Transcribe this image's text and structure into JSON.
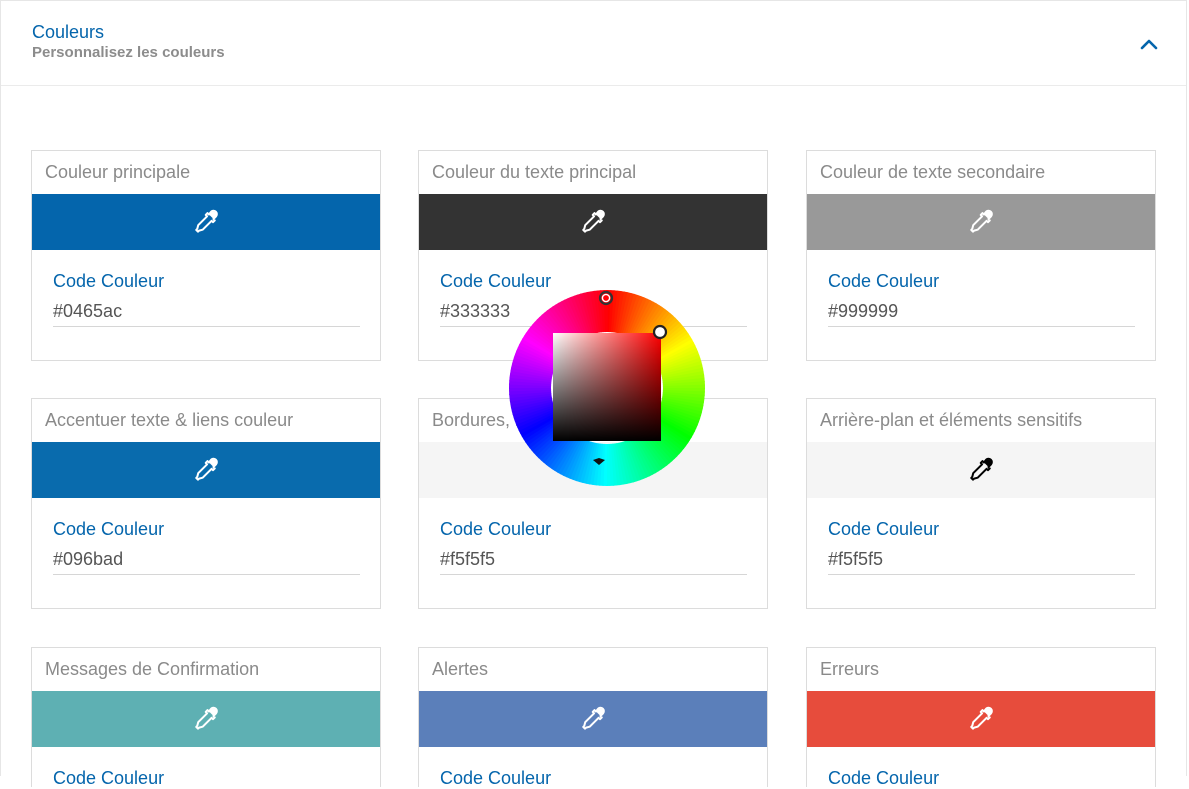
{
  "section": {
    "title": "Couleurs",
    "subtitle": "Personnalisez les couleurs",
    "collapse_icon": "chevron-up-icon"
  },
  "code_label": "Code Couleur",
  "cards": [
    {
      "title": "Couleur principale",
      "color": "#0465ac",
      "value": "#0465ac",
      "icon_color": "#ffffff"
    },
    {
      "title": "Couleur du texte principal",
      "color": "#333333",
      "value": "#333333",
      "icon_color": "#ffffff"
    },
    {
      "title": "Couleur de texte secondaire",
      "color": "#999999",
      "value": "#999999",
      "icon_color": "#ffffff"
    },
    {
      "title": "Accentuer texte & liens couleur",
      "color": "#096bad",
      "value": "#096bad",
      "icon_color": "#ffffff"
    },
    {
      "title": "Bordures, line",
      "color": "#f5f5f5",
      "value": "#f5f5f5",
      "icon_color": "#000000"
    },
    {
      "title": "Arrière-plan et éléments sensitifs",
      "color": "#f5f5f5",
      "value": "#f5f5f5",
      "icon_color": "#000000"
    },
    {
      "title": "Messages de Confirmation",
      "color": "#5eb0b3",
      "value": "",
      "icon_color": "#ffffff"
    },
    {
      "title": "Alertes",
      "color": "#5b7fba",
      "value": "",
      "icon_color": "#ffffff"
    },
    {
      "title": "Erreurs",
      "color": "#e74c3c",
      "value": "",
      "icon_color": "#ffffff"
    }
  ],
  "swatch_icon": "eyedropper-icon",
  "color_picker": {
    "icon": "color-wheel-icon",
    "hue_base": "#ff0000"
  }
}
